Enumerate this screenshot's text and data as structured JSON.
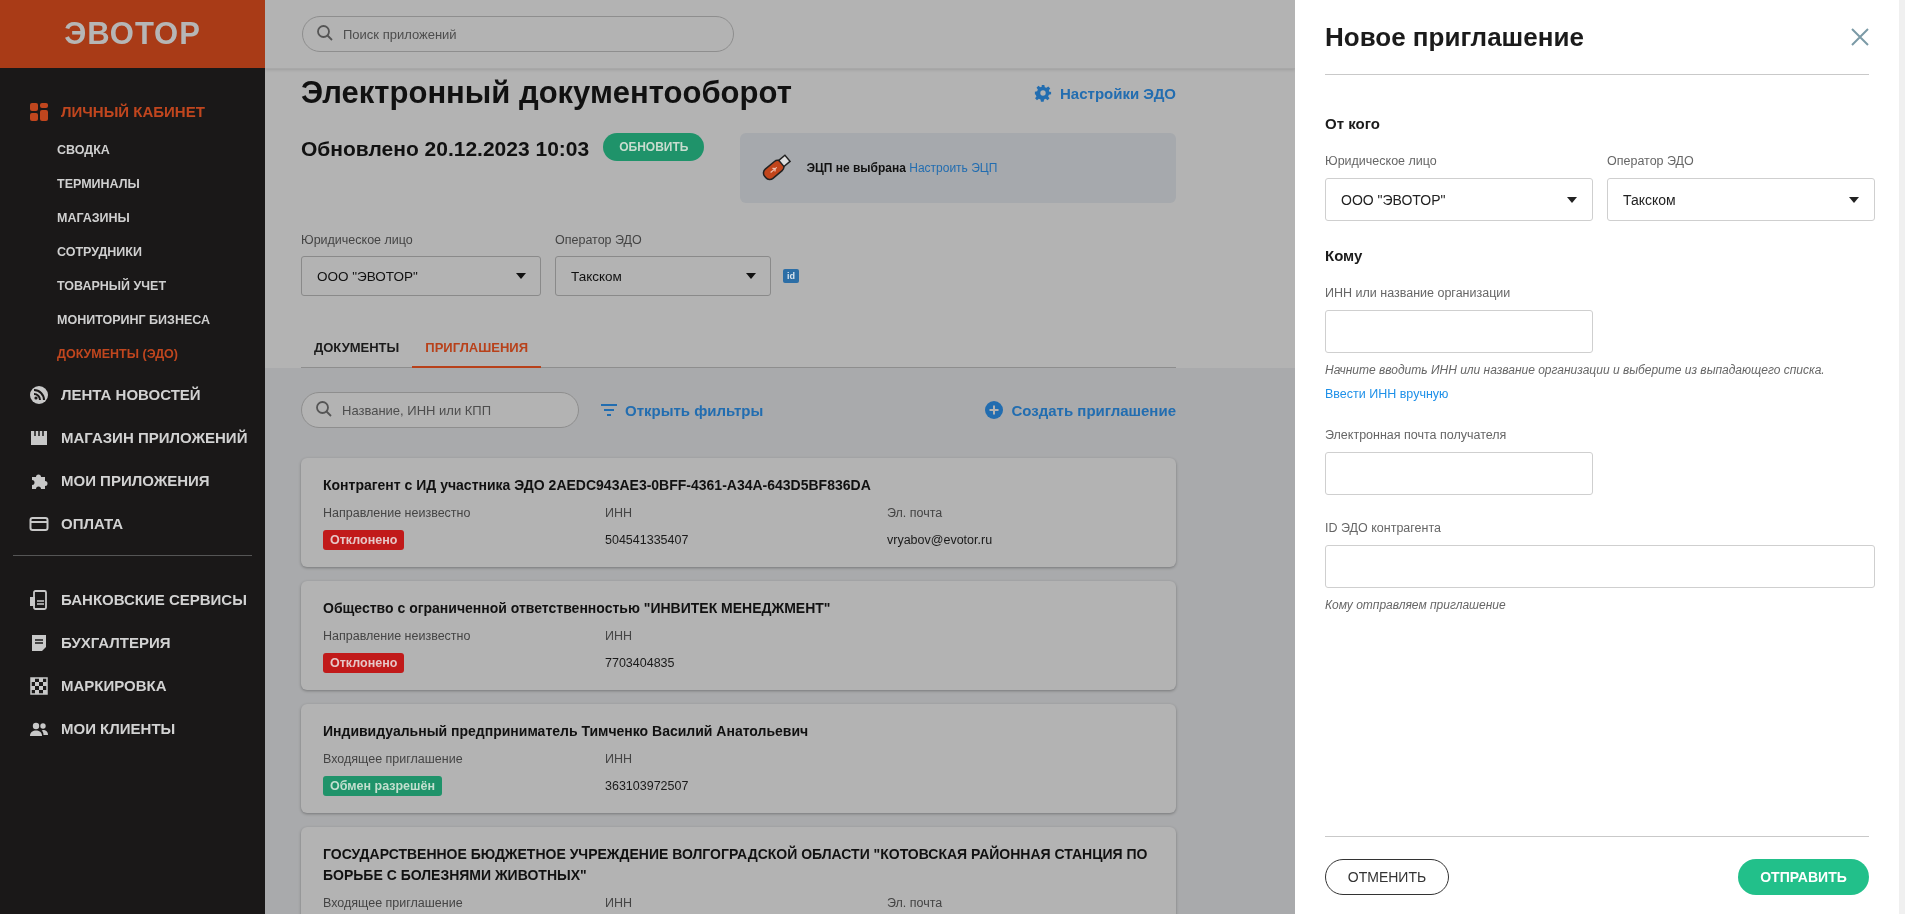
{
  "sidebar": {
    "logo": "ЭВОТОР",
    "groups": [
      [
        {
          "label": "ЛИЧНЫЙ КАБИНЕТ",
          "selected": true,
          "children": [
            {
              "label": "СВОДКА",
              "selected": false
            },
            {
              "label": "ТЕРМИНАЛЫ",
              "selected": false
            },
            {
              "label": "МАГАЗИНЫ",
              "selected": false
            },
            {
              "label": "СОТРУДНИКИ",
              "selected": false
            },
            {
              "label": "ТОВАРНЫЙ УЧЕТ",
              "selected": false
            },
            {
              "label": "МОНИТОРИНГ БИЗНЕСА",
              "selected": false
            },
            {
              "label": "ДОКУМЕНТЫ (ЭДО)",
              "selected": true
            }
          ]
        },
        {
          "label": "ЛЕНТА НОВОСТЕЙ",
          "selected": false
        },
        {
          "label": "МАГАЗИН ПРИЛОЖЕНИЙ",
          "selected": false
        },
        {
          "label": "МОИ ПРИЛОЖЕНИЯ",
          "selected": false
        },
        {
          "label": "ОПЛАТА",
          "selected": false
        }
      ],
      [
        {
          "label": "БАНКОВСКИЕ СЕРВИСЫ",
          "selected": false
        },
        {
          "label": "БУХГАЛТЕРИЯ",
          "selected": false
        },
        {
          "label": "МАРКИРОВКА",
          "selected": false
        },
        {
          "label": "МОИ КЛИЕНТЫ",
          "selected": false
        }
      ]
    ]
  },
  "header": {
    "search": {
      "placeholder": "Поиск приложений"
    }
  },
  "page": {
    "title": "Электронный документооборот",
    "settings_link": "Настройки ЭДО",
    "updated": "Обновлено 20.12.2023 10:03",
    "refresh_button": "ОБНОВИТЬ",
    "signature": {
      "status": "ЭЦП не выбрана",
      "link": "Настроить ЭЦП"
    },
    "filters": [
      {
        "label": "Юридическое лицо",
        "value": "ООО \"ЭВОТОР\""
      },
      {
        "label": "Оператор ЭДО",
        "value": "Такском"
      }
    ],
    "id_badge": "id",
    "tabs": [
      {
        "label": "ДОКУМЕНТЫ",
        "selected": false
      },
      {
        "label": "ПРИГЛАШЕНИЯ",
        "selected": true
      }
    ],
    "search": {
      "placeholder": "Название, ИНН или КПП"
    },
    "open_filters": "Открыть фильтры",
    "create_invitation": "Создать приглашение",
    "invitations": [
      {
        "title": "Контрагент с ИД участника ЭДО 2AEDC943AE3-0BFF-4361-A34A-643D5BF836DA",
        "direction": "Направление неизвестно",
        "status": {
          "text": "Отклонено",
          "kind": "rejected"
        },
        "fields": [
          {
            "label": "ИНН",
            "value": "504541335407"
          },
          {
            "label": "Эл. почта",
            "value": "vryabov@evotor.ru"
          }
        ]
      },
      {
        "title": "Общество с ограниченной ответственностью \"ИНВИТЕК МЕНЕДЖМЕНТ\"",
        "direction": "Направление неизвестно",
        "status": {
          "text": "Отклонено",
          "kind": "rejected"
        },
        "fields": [
          {
            "label": "ИНН",
            "value": "7703404835"
          }
        ]
      },
      {
        "title": "Индивидуальный предприниматель Тимченко Василий Анатольевич",
        "direction": "Входящее приглашение",
        "status": {
          "text": "Обмен разрешён",
          "kind": "allowed"
        },
        "fields": [
          {
            "label": "ИНН",
            "value": "363103972507"
          }
        ]
      },
      {
        "title": "ГОСУДАРСТВЕННОЕ БЮДЖЕТНОЕ УЧРЕЖДЕНИЕ ВОЛГОГРАДСКОЙ ОБЛАСТИ \"КОТОВСКАЯ РАЙОННАЯ СТАНЦИЯ ПО БОРЬБЕ С БОЛЕЗНЯМИ ЖИВОТНЫХ\"",
        "direction": "Входящее приглашение",
        "fields": [
          {
            "label": "ИНН"
          },
          {
            "label": "Эл. почта"
          }
        ]
      }
    ]
  },
  "panel": {
    "title": "Новое приглашение",
    "sections": [
      {
        "heading": "От кого",
        "fields": [
          {
            "kind": "select",
            "label": "Юридическое лицо",
            "value": "ООО \"ЭВОТОР\""
          },
          {
            "kind": "select",
            "label": "Оператор ЭДО",
            "value": "Такском"
          }
        ]
      },
      {
        "heading": "Кому",
        "fields": [
          {
            "kind": "input",
            "label": "ИНН или название организации",
            "hint": "Начните вводить ИНН или название организации и выберите из выпадающего списка.",
            "link": "Ввести ИНН вручную"
          },
          {
            "kind": "input",
            "label": "Электронная почта получателя"
          },
          {
            "kind": "wide",
            "label": "ID ЭДО контрагента",
            "hint": "Кому отправляем приглашение"
          }
        ]
      }
    ],
    "cancel_button": "ОТМЕНИТЬ",
    "send_button": "ОТПРАВИТЬ"
  }
}
